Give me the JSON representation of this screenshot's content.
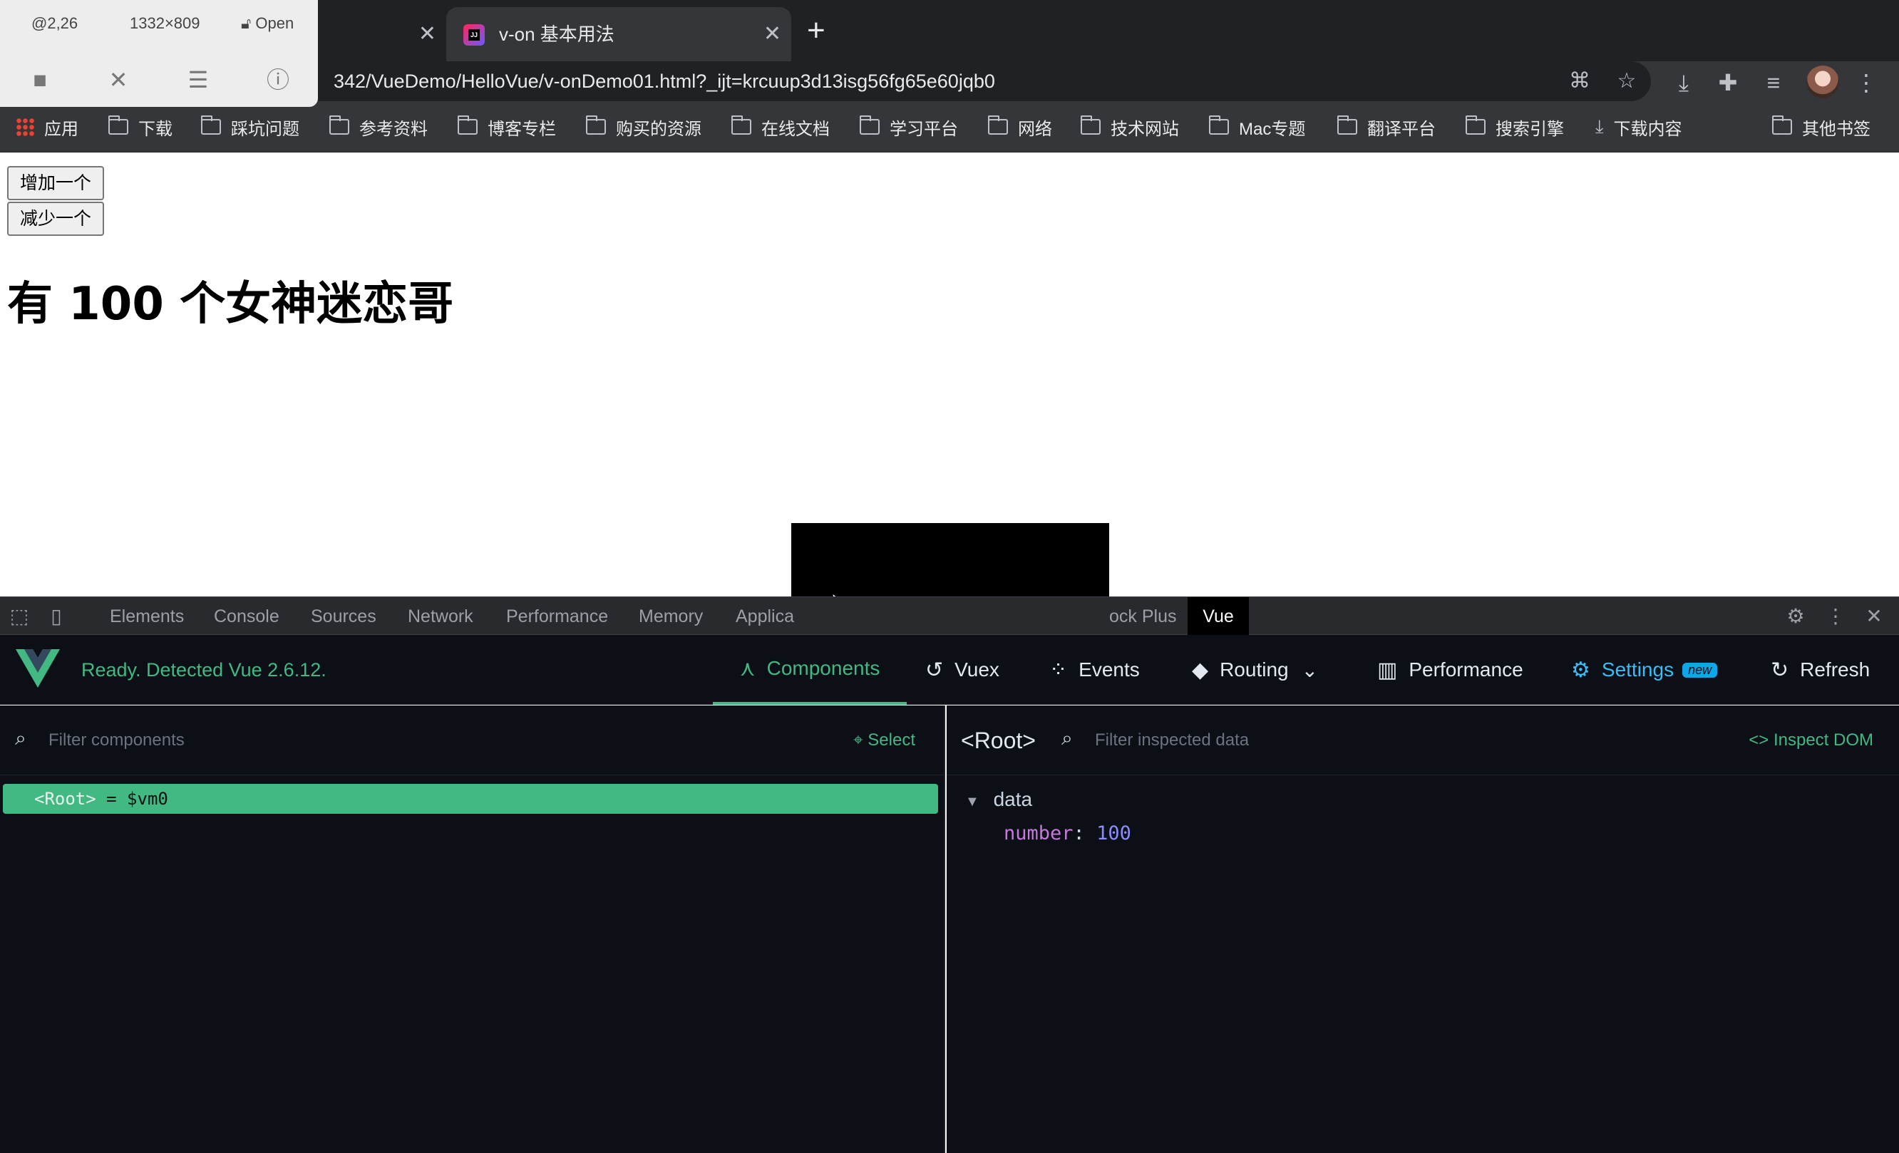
{
  "recorder": {
    "position": "@2,26",
    "size": "1332×809",
    "open_label": "Open"
  },
  "tabs": [
    {
      "title": ""
    },
    {
      "title": "v-on 基本用法"
    }
  ],
  "address_bar": {
    "url": "342/VueDemo/HelloVue/v-onDemo01.html?_ijt=krcuup3d13isg56fg65e60jqb0"
  },
  "bookmarks": {
    "apps": "应用",
    "items": [
      "下载",
      "踩坑问题",
      "参考资料",
      "博客专栏",
      "购买的资源",
      "在线文档",
      "学习平台",
      "网络",
      "技术网站",
      "Mac专题",
      "翻译平台",
      "搜索引擎"
    ],
    "downloads": "下载内容",
    "other": "其他书签"
  },
  "page": {
    "add_button": "增加一个",
    "sub_button": "减少一个",
    "heading": "有 100 个女神迷恋哥"
  },
  "devtools": {
    "tabs": [
      "Elements",
      "Console",
      "Sources",
      "Network",
      "Performance",
      "Memory",
      "Applica",
      "ock Plus",
      "Vue"
    ]
  },
  "vue": {
    "status": "Ready. Detected Vue 2.6.12.",
    "nav": {
      "components": "Components",
      "vuex": "Vuex",
      "events": "Events",
      "routing": "Routing",
      "performance": "Performance",
      "settings": "Settings",
      "new_badge": "new",
      "refresh": "Refresh"
    },
    "components_filter_placeholder": "Filter components",
    "select_label": "Select",
    "root_tag": "<Root>",
    "root_var": "= $vm0",
    "inspected": {
      "root": "<Root>",
      "filter_placeholder": "Filter inspected data",
      "inspect_dom": "Inspect DOM",
      "section": "data",
      "key": "number",
      "value": "100"
    }
  },
  "colors": {
    "vue_green": "#42b883",
    "devtools_bg": "#0c1016",
    "chrome_dark": "#202124"
  }
}
